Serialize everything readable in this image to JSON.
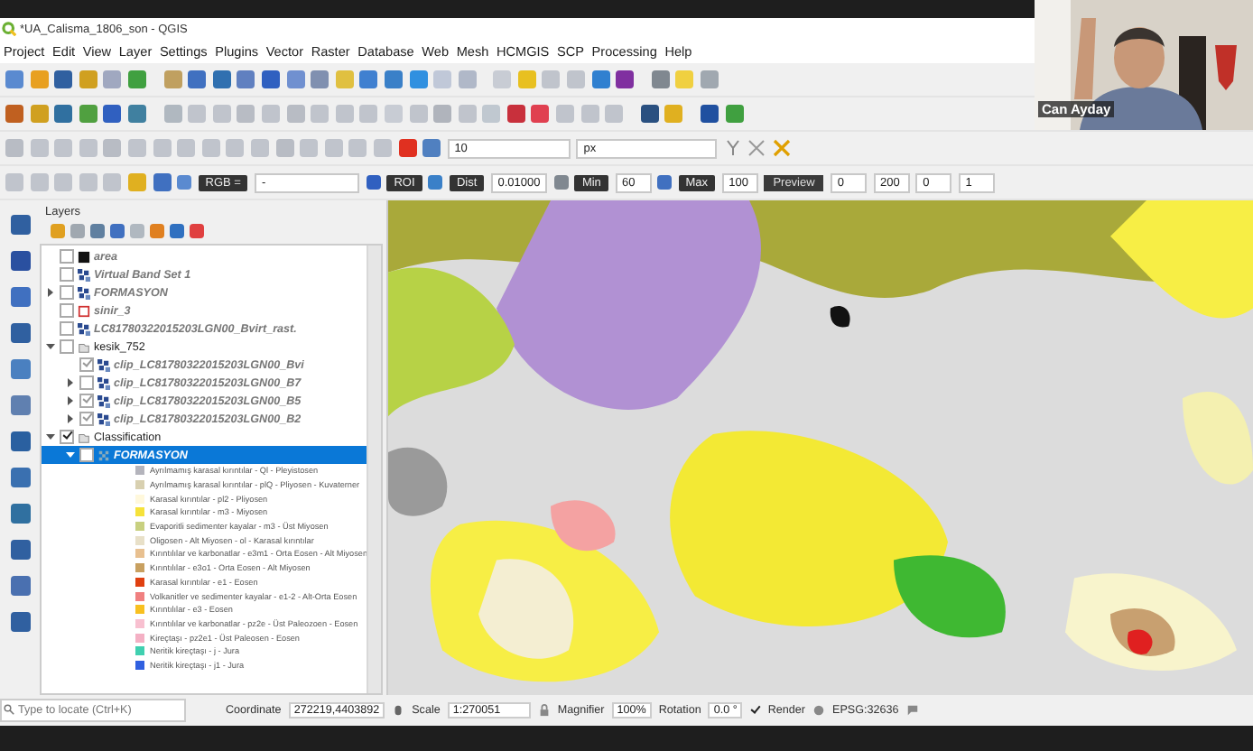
{
  "window": {
    "title": "*UA_Calisma_1806_son - QGIS"
  },
  "menu": [
    "Project",
    "Edit",
    "View",
    "Layer",
    "Settings",
    "Plugins",
    "Vector",
    "Raster",
    "Database",
    "Web",
    "Mesh",
    "HCMGIS",
    "SCP",
    "Processing",
    "Help"
  ],
  "digitizing_toolbar": {
    "snap_tolerance": "10",
    "unit": "px"
  },
  "scp_toolbar": [
    {
      "kind": "tag",
      "text": "RGB ="
    },
    {
      "kind": "dropdown",
      "text": "-"
    },
    {
      "kind": "tag",
      "text": "ROI"
    },
    {
      "kind": "tag",
      "text": "Dist"
    },
    {
      "kind": "spin",
      "text": "0.01000"
    },
    {
      "kind": "tag",
      "text": "Min"
    },
    {
      "kind": "spin",
      "text": "60"
    },
    {
      "kind": "tag",
      "text": "Max"
    },
    {
      "kind": "spin",
      "text": "100"
    },
    {
      "kind": "button",
      "text": "Preview"
    },
    {
      "kind": "spin",
      "text": "0"
    },
    {
      "kind": "spin",
      "text": "200"
    },
    {
      "kind": "spin",
      "text": "0"
    },
    {
      "kind": "spin",
      "text": "1"
    }
  ],
  "layers_panel": {
    "title": "Layers",
    "items": [
      {
        "label": "area",
        "kind": "solid-fill",
        "checked": false,
        "dimmed": true,
        "selected": false
      },
      {
        "label": "Virtual Band Set 1",
        "kind": "raster",
        "checked": false,
        "dimmed": true,
        "selected": false
      },
      {
        "label": "FORMASYON",
        "kind": "raster",
        "checked": false,
        "dimmed": true,
        "selected": false,
        "expanded": false
      },
      {
        "label": "sinir_3",
        "kind": "outline",
        "checked": false,
        "dimmed": true,
        "selected": false
      },
      {
        "label": "LC81780322015203LGN00_Bvirt_rast.",
        "kind": "raster",
        "checked": false,
        "dimmed": true,
        "selected": false
      },
      {
        "label": "kesik_752",
        "kind": "group",
        "checked": false,
        "dimmed": false,
        "selected": false,
        "expanded": true,
        "children": [
          {
            "label": "clip_LC81780322015203LGN00_Bvi",
            "kind": "raster",
            "checked": true,
            "dimmed": true,
            "selected": false
          },
          {
            "label": "clip_LC81780322015203LGN00_B7",
            "kind": "raster",
            "checked": false,
            "dimmed": true,
            "selected": false,
            "expanded": false
          },
          {
            "label": "clip_LC81780322015203LGN00_B5",
            "kind": "raster",
            "checked": true,
            "dimmed": true,
            "selected": false,
            "expanded": false
          },
          {
            "label": "clip_LC81780322015203LGN00_B2",
            "kind": "raster",
            "checked": true,
            "dimmed": true,
            "selected": false,
            "expanded": false
          }
        ]
      },
      {
        "label": "Classification",
        "kind": "group",
        "checked": true,
        "dimmed": false,
        "selected": false,
        "expanded": true,
        "children": [
          {
            "label": "FORMASYON",
            "kind": "classified",
            "checked": false,
            "dimmed": true,
            "selected": true,
            "expanded": true,
            "legend": [
              {
                "label": "Ayrılmamış karasal kırıntılar - Ql - Pleyistosen",
                "color": "#b4b4bc"
              },
              {
                "label": "Ayrılmamış karasal kırıntılar - plQ - Pliyosen - Kuvaterner",
                "color": "#d8d0b0"
              },
              {
                "label": "Karasal kırıntılar - pl2 - Pliyosen",
                "color": "#fff8dc"
              },
              {
                "label": "Karasal kırıntılar - m3 - Miyosen",
                "color": "#f6e23a"
              },
              {
                "label": "Evaporitli sedimenter kayalar - m3 - Üst Miyosen",
                "color": "#c8d080"
              },
              {
                "label": "Oligosen - Alt Miyosen - ol - Karasal kırıntılar",
                "color": "#e8e0c8"
              },
              {
                "label": "Kırıntılılar ve karbonatlar - e3m1 - Orta Eosen - Alt Miyosen",
                "color": "#e8c090"
              },
              {
                "label": "Kırıntılılar - e3o1 - Orta Eosen - Alt Miyosen",
                "color": "#c8a060"
              },
              {
                "label": "Karasal kırıntılar - e1 - Eosen",
                "color": "#e04010"
              },
              {
                "label": "Volkanitler ve sedimenter kayalar - e1-2 - Alt-Orta Eosen",
                "color": "#f08080"
              },
              {
                "label": "Kırıntılılar - e3 - Eosen",
                "color": "#f8c020"
              },
              {
                "label": "Kırıntılılar ve karbonatlar - pz2e - Üst Paleozoen - Eosen",
                "color": "#f8c0d0"
              },
              {
                "label": "Kireçtaşı - pz2e1 - Üst Paleosen - Eosen",
                "color": "#f4b0c4"
              },
              {
                "label": "Neritik kireçtaşı - j - Jura",
                "color": "#40d0b0"
              },
              {
                "label": "Neritik kireçtaşı - j1 - Jura",
                "color": "#3060e0"
              }
            ]
          }
        ]
      }
    ]
  },
  "locator": {
    "placeholder": "Type to locate (Ctrl+K)"
  },
  "status_bar": {
    "coordinate_label": "Coordinate",
    "coordinate": "272219,4403892",
    "scale_label": "Scale",
    "scale": "1:270051",
    "magnifier_label": "Magnifier",
    "magnifier": "100%",
    "rotation_label": "Rotation",
    "rotation": "0.0 °",
    "render_label": "Render",
    "render_checked": true,
    "crs": "EPSG:32636"
  },
  "video": {
    "participant": "Can Ayday"
  }
}
